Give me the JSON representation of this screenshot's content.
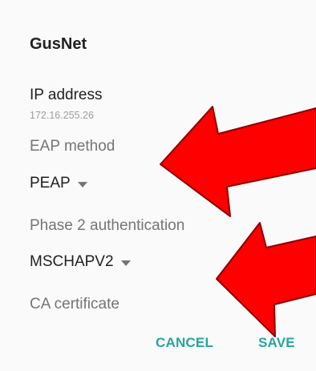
{
  "dialog": {
    "title": "GusNet",
    "ip_label": "IP address",
    "ip_value": "172.16.255.26",
    "eap_label": "EAP method",
    "eap_value": "PEAP",
    "phase2_label": "Phase 2 authentication",
    "phase2_value": "MSCHAPV2",
    "ca_label": "CA certificate",
    "cancel_label": "CANCEL",
    "save_label": "SAVE"
  },
  "colors": {
    "accent": "#26a69a",
    "arrow_fill": "#ff0000",
    "arrow_stroke": "#8b0000"
  },
  "icons": {
    "dropdown": "chevron-down-icon",
    "annotation": "red-arrow-icon"
  }
}
